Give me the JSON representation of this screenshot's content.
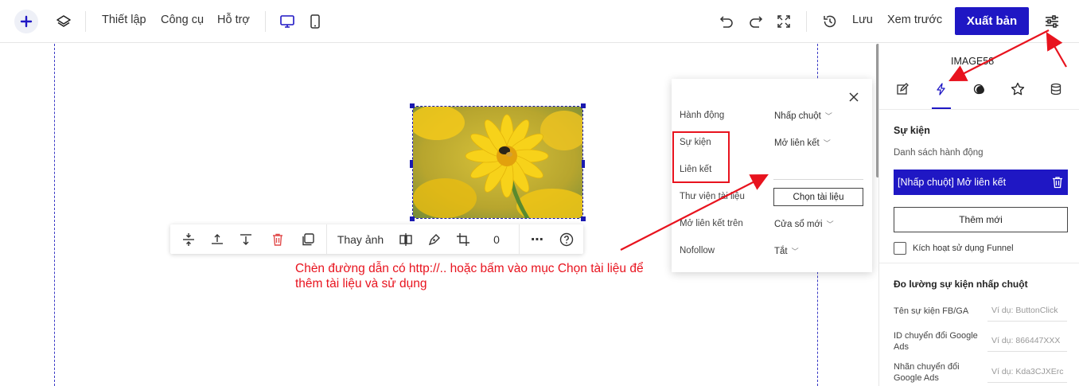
{
  "topbar": {
    "menu": [
      "Thiết lập",
      "Công cụ",
      "Hỗ trợ"
    ],
    "save_label": "Lưu",
    "preview_label": "Xem trước",
    "publish_label": "Xuất bản"
  },
  "image_toolbar": {
    "replace_label": "Thay ảnh",
    "rotation_value": "0"
  },
  "popup": {
    "rows": [
      {
        "label": "Hành động",
        "value": "Nhấp chuột"
      },
      {
        "label": "Sự kiện",
        "value": "Mở liên kết"
      },
      {
        "label": "Liên kết",
        "value": ""
      },
      {
        "label": "Thư viện tài liệu",
        "button": "Chọn tài liệu"
      },
      {
        "label": "Mở liên kết trên",
        "value": "Cửa sổ mới"
      },
      {
        "label": "Nofollow",
        "value": "Tắt"
      }
    ]
  },
  "annotation": {
    "text": "Chèn đường dẫn có http://.. hoặc bấm vào mục Chọn tài liệu để thêm tài liệu và sử dụng"
  },
  "right_panel": {
    "element_name": "IMAGE58",
    "events_heading": "Sự kiện",
    "action_list_label": "Danh sách hành động",
    "action_item": "[Nhấp chuột] Mở liên kết",
    "add_new_label": "Thêm mới",
    "funnel_label": "Kích hoạt sử dụng Funnel",
    "tracking_heading": "Đo lường sự kiện nhấp chuột",
    "fields": [
      {
        "label": "Tên sự kiện FB/GA",
        "placeholder": "Ví dụ: ButtonClick"
      },
      {
        "label": "ID chuyển đổi Google Ads",
        "placeholder": "Ví dụ: 866447XXX"
      },
      {
        "label": "Nhãn chuyển đổi Google Ads",
        "placeholder": "Ví dụ: Kda3CJXErc"
      }
    ]
  },
  "colors": {
    "brand": "#1f17c4",
    "annotation_red": "#e8131e"
  },
  "icons": [
    "plus-icon",
    "layers-icon",
    "desktop-icon",
    "mobile-icon",
    "undo-icon",
    "redo-icon",
    "fullscreen-icon",
    "history-icon",
    "settings-sliders-icon",
    "edit-icon",
    "lightning-icon",
    "contrast-icon",
    "star-icon",
    "database-icon",
    "trash-icon",
    "close-icon"
  ]
}
